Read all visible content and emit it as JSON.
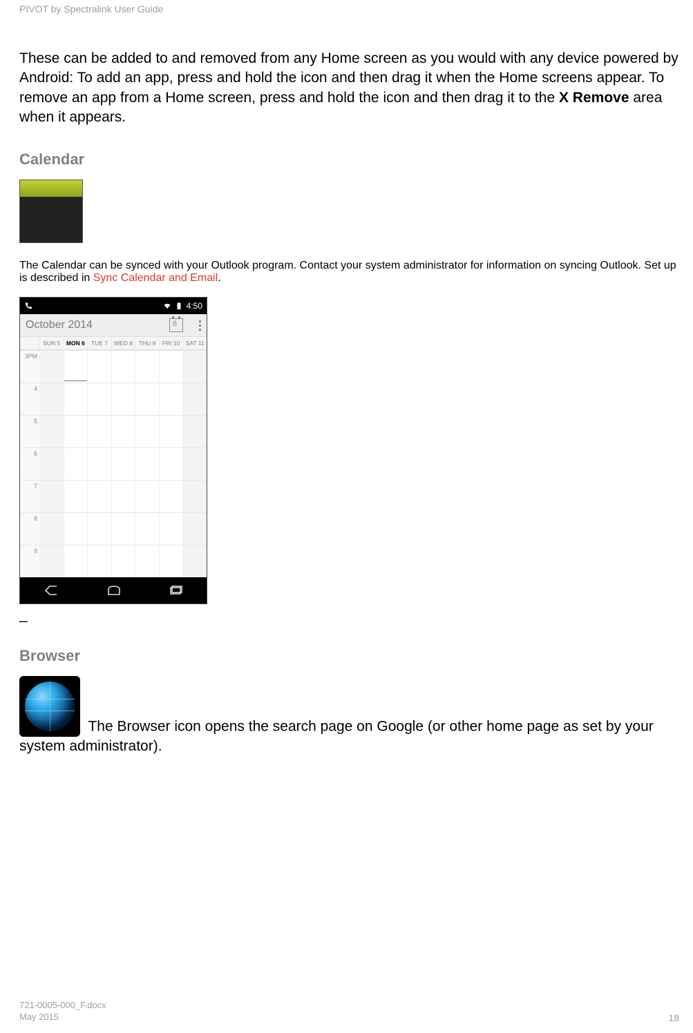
{
  "doc_header": "PIVOT by Spectralink User Guide",
  "intro": {
    "part1": "These can be added to and removed from any Home screen as you would with any device powered by Android: To add an app, press and hold the icon and then drag it when the Home screens appear. To remove an app from a Home screen, press and hold the icon and then drag it to the ",
    "bold": "X Remove",
    "part2": " area when it appears."
  },
  "calendar_section": {
    "heading": "Calendar",
    "text1": " The Calendar can be synced with your Outlook program. Contact your system administrator for information on syncing Outlook. Set up is described in ",
    "link": "Sync Calendar and Email",
    "text2": "."
  },
  "screenshot": {
    "status_time": "4:50",
    "month_label": "October 2014",
    "today_number": "6",
    "days": [
      {
        "label": "SUN 5",
        "today": false
      },
      {
        "label": "MON 6",
        "today": true
      },
      {
        "label": "TUE 7",
        "today": false
      },
      {
        "label": "WED 8",
        "today": false
      },
      {
        "label": "THU 9",
        "today": false
      },
      {
        "label": "FRI 10",
        "today": false
      },
      {
        "label": "SAT 11",
        "today": false
      }
    ],
    "times": [
      "3",
      "4",
      "5",
      "6",
      "7",
      "8",
      "9"
    ],
    "pm_label": "PM"
  },
  "browser_section": {
    "heading": "Browser",
    "text": " The Browser icon opens the search page on Google (or other home page as set by your system administrator)."
  },
  "footer": {
    "filename": "721-0005-000_F.docx",
    "date": "May 2015",
    "page": "18"
  }
}
